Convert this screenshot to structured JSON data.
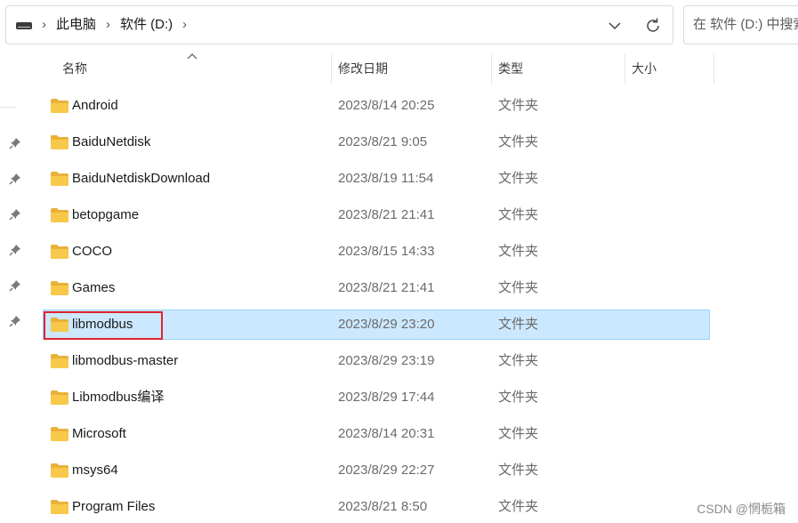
{
  "breadcrumb": {
    "items": [
      "此电脑",
      "软件 (D:)"
    ],
    "separator": "›"
  },
  "search": {
    "placeholder": "在 软件 (D:) 中搜索"
  },
  "columns": {
    "name": "名称",
    "modified": "修改日期",
    "type": "类型",
    "size": "大小"
  },
  "files": [
    {
      "name": "Android",
      "modified": "2023/8/14 20:25",
      "type": "文件夹",
      "selected": false
    },
    {
      "name": "BaiduNetdisk",
      "modified": "2023/8/21 9:05",
      "type": "文件夹",
      "selected": false
    },
    {
      "name": "BaiduNetdiskDownload",
      "modified": "2023/8/19 11:54",
      "type": "文件夹",
      "selected": false
    },
    {
      "name": "betopgame",
      "modified": "2023/8/21 21:41",
      "type": "文件夹",
      "selected": false
    },
    {
      "name": "COCO",
      "modified": "2023/8/15 14:33",
      "type": "文件夹",
      "selected": false
    },
    {
      "name": "Games",
      "modified": "2023/8/21 21:41",
      "type": "文件夹",
      "selected": false
    },
    {
      "name": "libmodbus",
      "modified": "2023/8/29 23:20",
      "type": "文件夹",
      "selected": true
    },
    {
      "name": "libmodbus-master",
      "modified": "2023/8/29 23:19",
      "type": "文件夹",
      "selected": false
    },
    {
      "name": "Libmodbus编译",
      "modified": "2023/8/29 17:44",
      "type": "文件夹",
      "selected": false
    },
    {
      "name": "Microsoft",
      "modified": "2023/8/14 20:31",
      "type": "文件夹",
      "selected": false
    },
    {
      "name": "msys64",
      "modified": "2023/8/29 22:27",
      "type": "文件夹",
      "selected": false
    },
    {
      "name": "Program Files",
      "modified": "2023/8/21 8:50",
      "type": "文件夹",
      "selected": false
    }
  ],
  "watermark": "CSDN @惘栀箱",
  "colors": {
    "selection_bg": "#cce8ff",
    "selection_border": "#99d1ff",
    "highlight_box": "#e0242c",
    "folder_yellow": "#f8c84a"
  },
  "icons": {
    "drive": "drive-icon",
    "folder": "folder-icon",
    "pin": "pin-icon",
    "refresh": "refresh-icon",
    "dropdown": "chevron-down-icon",
    "sort": "sort-up-icon"
  }
}
